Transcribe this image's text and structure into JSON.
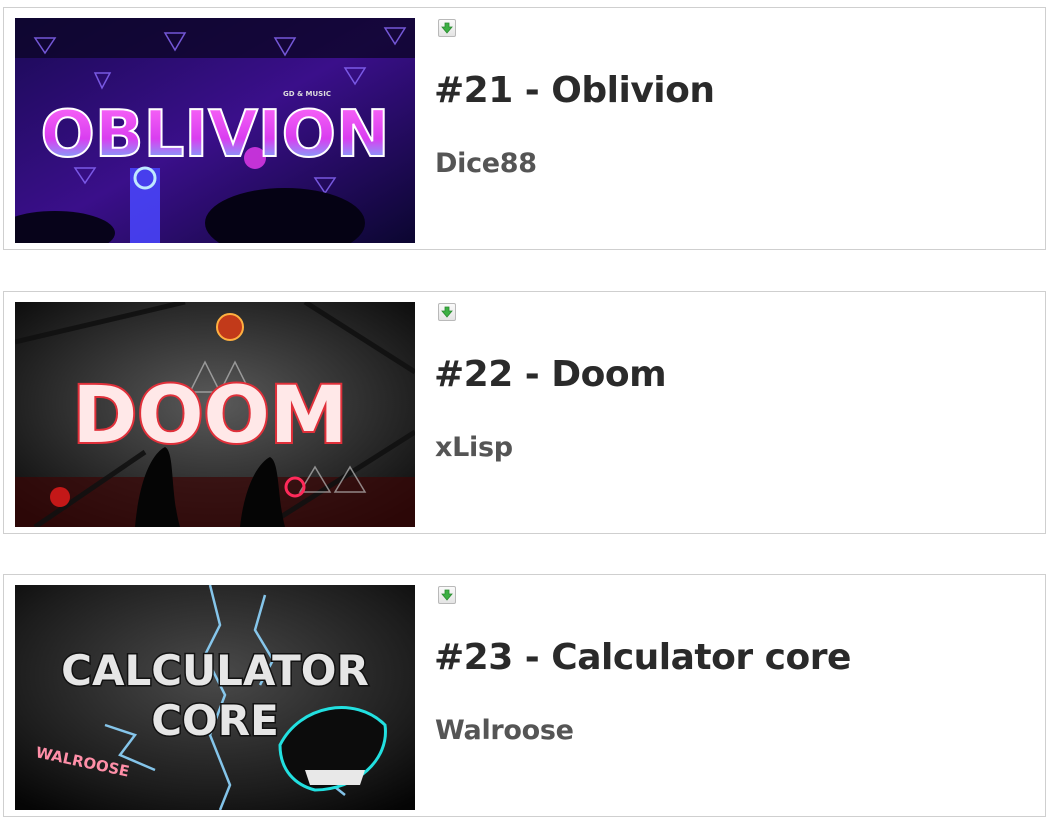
{
  "entries": [
    {
      "rank_title": "#21 - Oblivion",
      "creator": "Dice88",
      "thumbnail": {
        "icon": "level-thumbnail-oblivion",
        "text": "OBLIVION",
        "caption": "GD & MUSIC",
        "accent": "#ff3df5",
        "glow": "#3fd6ff"
      },
      "download_icon": "download-arrow-icon"
    },
    {
      "rank_title": "#22 - Doom",
      "creator": "xLisp",
      "thumbnail": {
        "icon": "level-thumbnail-doom",
        "text": "DOOM",
        "accent": "#e0303a",
        "glow": "#ff8080"
      },
      "download_icon": "download-arrow-icon"
    },
    {
      "rank_title": "#23 - Calculator core",
      "creator": "Walroose",
      "thumbnail": {
        "icon": "level-thumbnail-calculator-core",
        "text_line1": "CALCULATOR",
        "text_line2": "CORE",
        "signature": "WALROOSE",
        "accent": "#dcdcdc",
        "glow": "#7fd0ff"
      },
      "download_icon": "download-arrow-icon"
    }
  ],
  "colors": {
    "title": "#2a2a2a",
    "creator": "#555555",
    "card_border": "#cfcfcf",
    "download_arrow": "#3cb043"
  }
}
